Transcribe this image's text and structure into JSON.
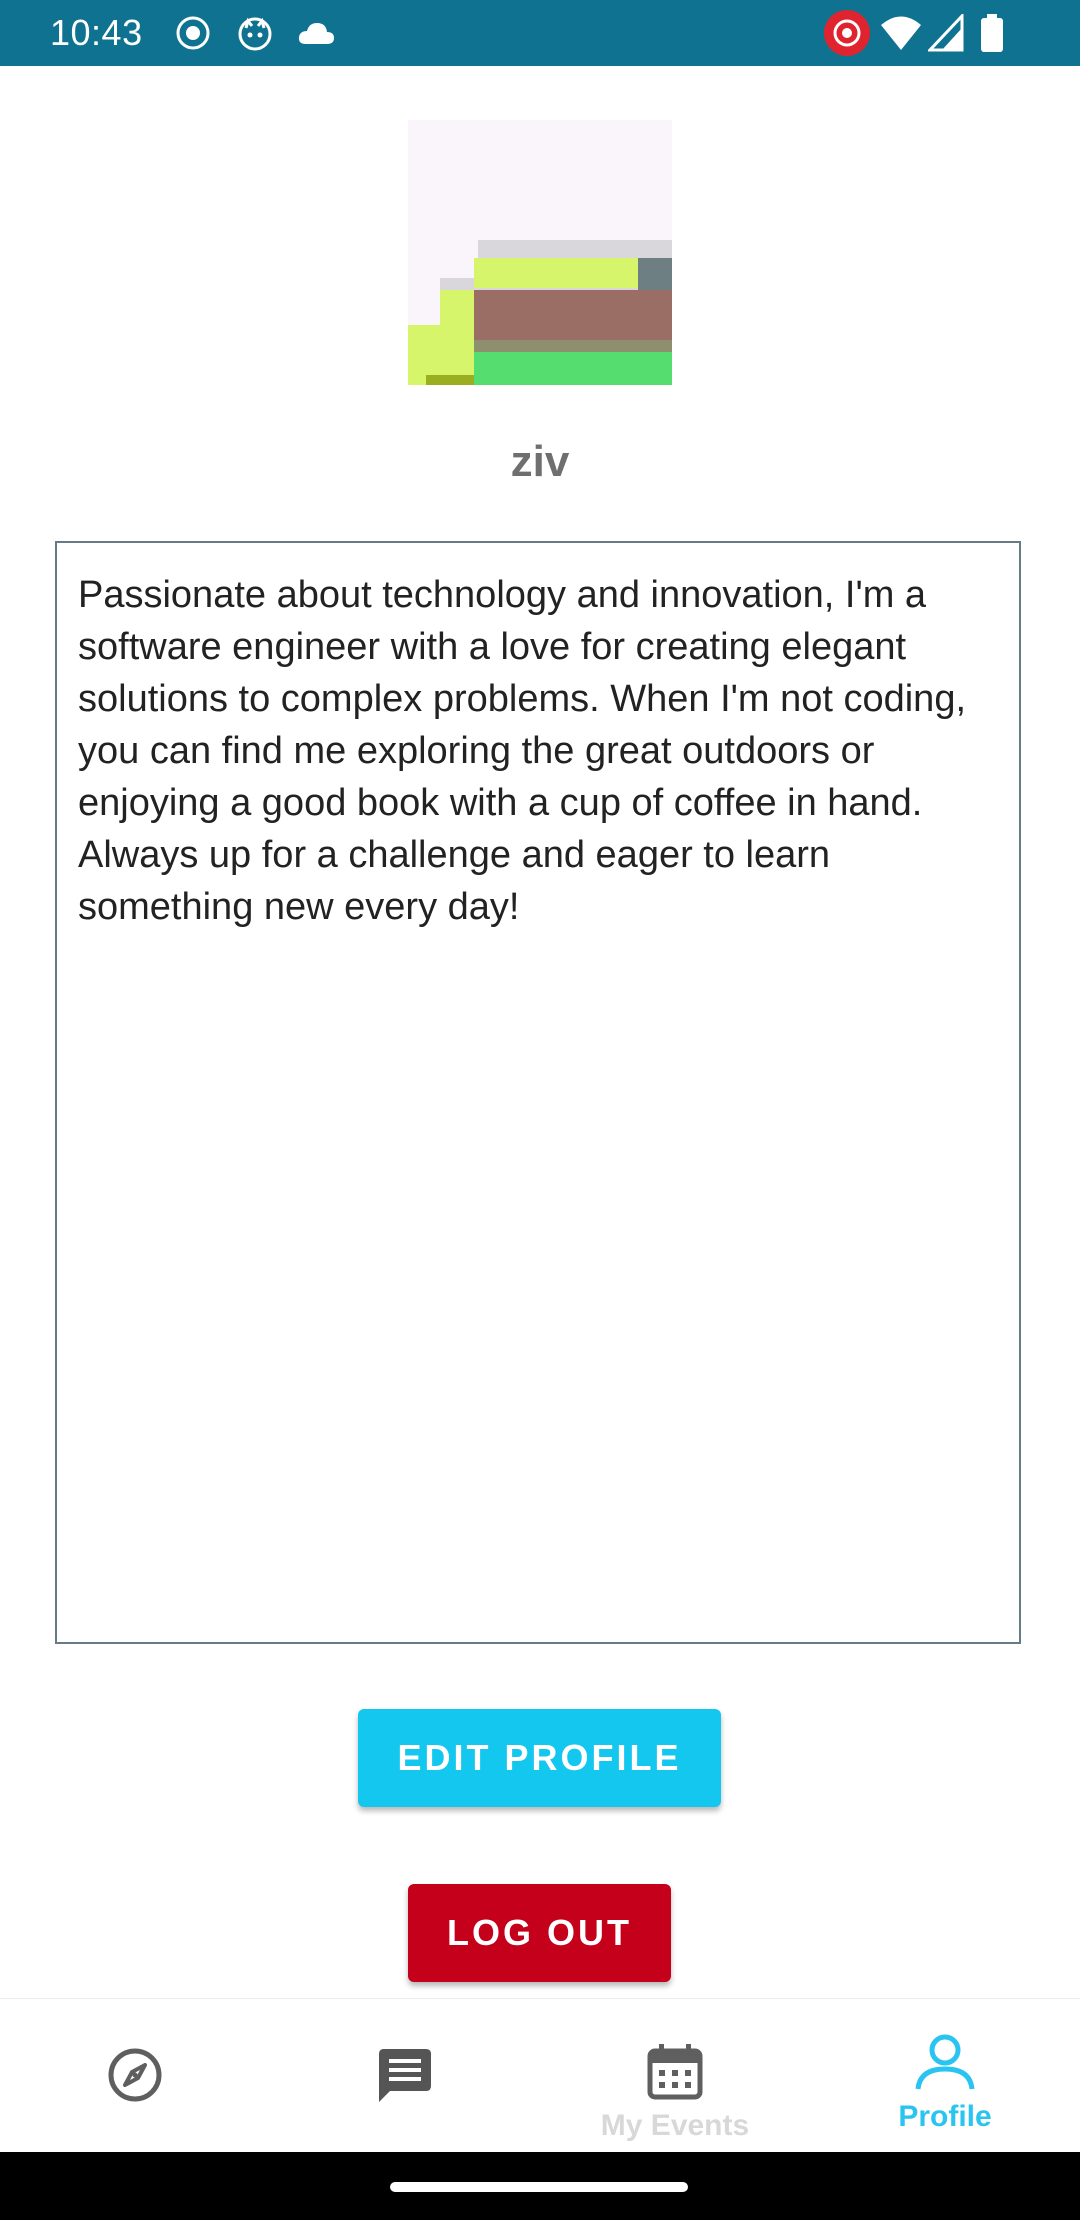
{
  "status_bar": {
    "time": "10:43",
    "background": "#0e7290",
    "icons_left": [
      "record-icon",
      "cat-icon",
      "cloud-icon"
    ],
    "icons_right": [
      "cast-record-icon",
      "wifi-icon",
      "signal-icon",
      "battery-icon"
    ]
  },
  "profile": {
    "username": "ziv",
    "bio": "Passionate about technology and innovation, I'm a software engineer with a love for creating elegant solutions to complex problems. When I'm not coding, you can find me exploring the great outdoors or enjoying a good book with a cup of coffee in hand. Always up for a challenge and eager to learn something new every day!"
  },
  "actions": {
    "edit_profile_label": "EDIT PROFILE",
    "edit_profile_color": "#13c7ef",
    "log_out_label": "LOG OUT",
    "log_out_color": "#c5001a"
  },
  "bottom_nav": {
    "items": [
      {
        "icon": "compass-icon",
        "label": "",
        "active": false
      },
      {
        "icon": "chat-icon",
        "label": "",
        "active": false
      },
      {
        "icon": "calendar-icon",
        "label": "My Events",
        "active": false
      },
      {
        "icon": "person-icon",
        "label": "Profile",
        "active": true
      }
    ],
    "active_color": "#29c5f0",
    "inactive_color": "#d8d8d8"
  }
}
